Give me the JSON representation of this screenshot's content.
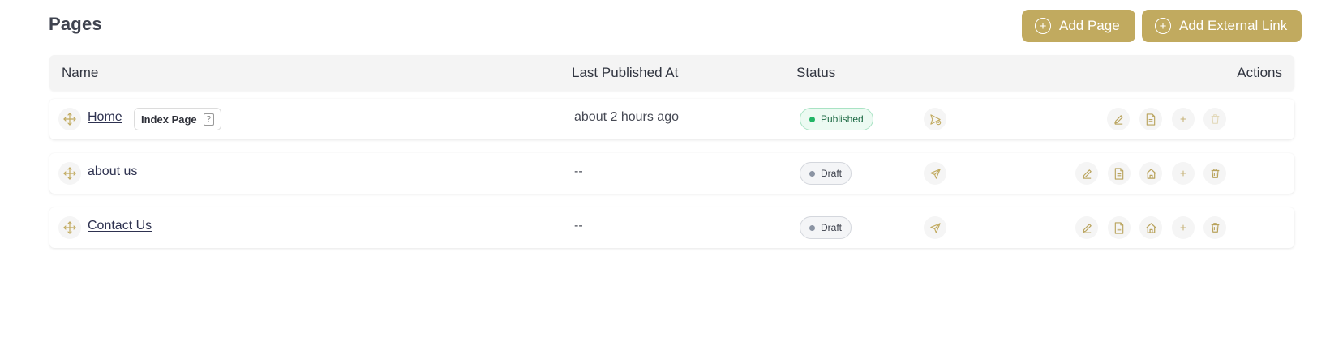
{
  "page": {
    "title": "Pages"
  },
  "toolbar": {
    "add_page_label": "Add Page",
    "add_link_label": "Add External Link"
  },
  "table": {
    "headers": {
      "name": "Name",
      "last_published": "Last Published At",
      "status": "Status",
      "actions": "Actions"
    },
    "rows": [
      {
        "name": "Home",
        "index_badge": "Index Page",
        "index_help": "?",
        "last_published": "about 2 hours ago",
        "status": "Published"
      },
      {
        "name": "about us",
        "last_published": "--",
        "status": "Draft"
      },
      {
        "name": "Contact Us",
        "last_published": "--",
        "status": "Draft"
      }
    ]
  },
  "colors": {
    "accent": "#c1aa5f",
    "published_bg": "#ecfaf2",
    "published_dot": "#22b566",
    "draft_dot": "#8b94a3",
    "icon": "#b9a35c",
    "icon_disabled": "#e0d6b6"
  },
  "icons": [
    "plus-circle-icon",
    "drag-move-icon",
    "help-icon",
    "send-icon",
    "pencil-icon",
    "document-icon",
    "home-icon",
    "plus-icon",
    "trash-icon"
  ]
}
